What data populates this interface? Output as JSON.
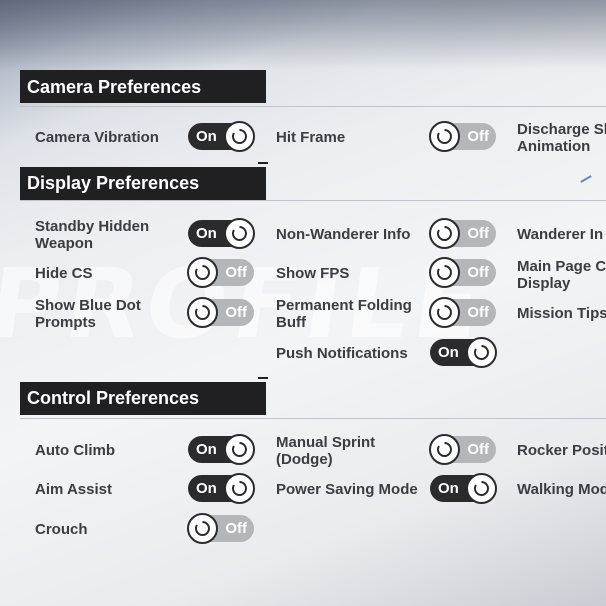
{
  "watermark": "PROFILE",
  "sections": {
    "camera": "Camera Preferences",
    "display": "Display Preferences",
    "control": "Control Preferences"
  },
  "toggle_text": {
    "on": "On",
    "off": "Off"
  },
  "camera": {
    "camera_vibration": {
      "label": "Camera Vibration",
      "state": "on"
    },
    "hit_frame": {
      "label": "Hit Frame",
      "state": "off"
    },
    "discharge_skill_animation": {
      "label_line1": "Discharge Sk",
      "label_line2": "Animation"
    }
  },
  "display": {
    "standby_hidden_weapon": {
      "label_line1": "Standby Hidden",
      "label_line2": "Weapon",
      "state": "on"
    },
    "non_wanderer_info": {
      "label": "Non-Wanderer Info",
      "state": "off"
    },
    "wanderer_info": {
      "label": "Wanderer In"
    },
    "hide_cs": {
      "label": "Hide CS",
      "state": "off"
    },
    "show_fps": {
      "label": "Show FPS",
      "state": "off"
    },
    "main_page_display": {
      "label_line1": "Main Page Cl",
      "label_line2": "Display"
    },
    "show_blue_dot_prompts": {
      "label_line1": "Show Blue Dot",
      "label_line2": "Prompts",
      "state": "off"
    },
    "permanent_folding_buff": {
      "label_line1": "Permanent Folding",
      "label_line2": "Buff",
      "state": "off"
    },
    "mission_tips": {
      "label": "Mission Tips"
    },
    "push_notifications": {
      "label": "Push Notifications",
      "state": "on"
    }
  },
  "control": {
    "auto_climb": {
      "label": "Auto Climb",
      "state": "on"
    },
    "manual_sprint": {
      "label_line1": "Manual Sprint",
      "label_line2": "(Dodge)",
      "state": "off"
    },
    "rocker_position": {
      "label": "Rocker Positi"
    },
    "aim_assist": {
      "label": "Aim Assist",
      "state": "on"
    },
    "power_saving_mode": {
      "label": "Power Saving Mode",
      "state": "on"
    },
    "walking_mode": {
      "label": "Walking Mod"
    },
    "crouch": {
      "label": "Crouch",
      "state": "off"
    }
  },
  "colors": {
    "on_track": "#2b2b2d",
    "off_track": "#b4b6ba",
    "header_bg": "#202022",
    "text": "#3b3d42"
  }
}
